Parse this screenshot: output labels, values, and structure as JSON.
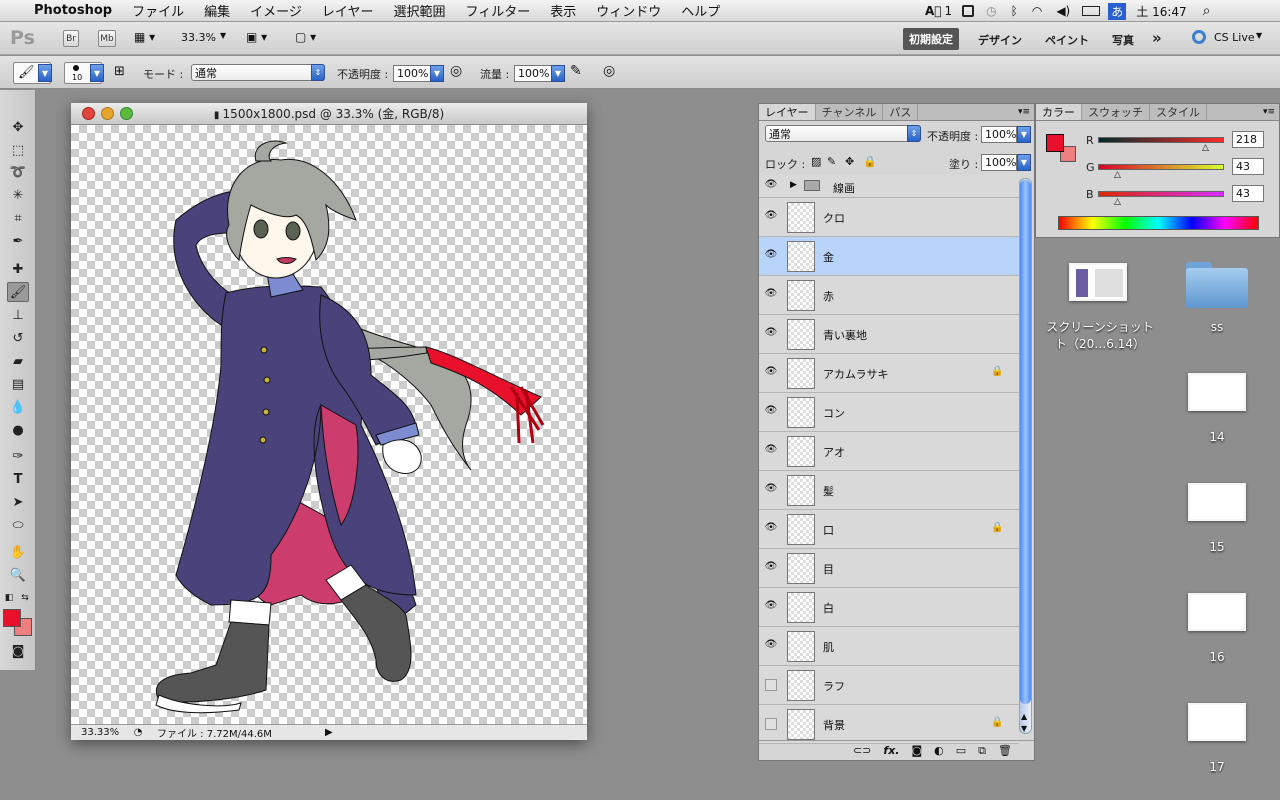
{
  "menubar": {
    "app_name": "Photoshop",
    "items": [
      "ファイル",
      "編集",
      "イメージ",
      "レイヤー",
      "選択範囲",
      "フィルター",
      "表示",
      "ウィンドウ",
      "ヘルプ"
    ],
    "tray_num": "1",
    "ime": "あ",
    "clock": "土 16:47"
  },
  "appbar": {
    "logo": "Ps",
    "br": "Br",
    "mb": "Mb",
    "zoom": "33.3%",
    "workspaces": [
      "初期設定",
      "デザイン",
      "ペイント",
      "写真"
    ],
    "more": "»",
    "cs_live": "CS Live"
  },
  "options": {
    "brush_size": "10",
    "mode_label": "モード :",
    "mode_value": "通常",
    "opacity_label": "不透明度 :",
    "opacity_value": "100%",
    "flow_label": "流量 :",
    "flow_value": "100%"
  },
  "document": {
    "title": "1500x1800.psd @ 33.3% (金, RGB/8)",
    "zoom_status": "33.33%",
    "file_status": "ファイル : 7.72M/44.6M"
  },
  "layers_panel": {
    "tabs": [
      "レイヤー",
      "チャンネル",
      "パス"
    ],
    "blend_mode": "通常",
    "opacity_label": "不透明度 :",
    "opacity_value": "100%",
    "lock_label": "ロック :",
    "fill_label": "塗り :",
    "fill_value": "100%",
    "group_name": "線画",
    "layers": [
      {
        "name": "クロ",
        "visible": true,
        "locked": false,
        "selected": false
      },
      {
        "name": "金",
        "visible": true,
        "locked": false,
        "selected": true
      },
      {
        "name": "赤",
        "visible": true,
        "locked": false,
        "selected": false
      },
      {
        "name": "青い裏地",
        "visible": true,
        "locked": false,
        "selected": false
      },
      {
        "name": "アカムラサキ",
        "visible": true,
        "locked": true,
        "selected": false
      },
      {
        "name": "コン",
        "visible": true,
        "locked": false,
        "selected": false
      },
      {
        "name": "アオ",
        "visible": true,
        "locked": false,
        "selected": false
      },
      {
        "name": "髪",
        "visible": true,
        "locked": false,
        "selected": false
      },
      {
        "name": "口",
        "visible": true,
        "locked": true,
        "selected": false
      },
      {
        "name": "目",
        "visible": true,
        "locked": false,
        "selected": false
      },
      {
        "name": "白",
        "visible": true,
        "locked": false,
        "selected": false
      },
      {
        "name": "肌",
        "visible": true,
        "locked": false,
        "selected": false
      },
      {
        "name": "ラフ",
        "visible": false,
        "locked": false,
        "selected": false
      },
      {
        "name": "背景",
        "visible": false,
        "locked": true,
        "selected": false
      }
    ]
  },
  "color_panel": {
    "tabs": [
      "カラー",
      "スウォッチ",
      "スタイル"
    ],
    "r_label": "R",
    "r_value": "218",
    "g_label": "G",
    "g_value": "43",
    "b_label": "B",
    "b_value": "43",
    "foreground": "#da2b2b",
    "background": "#f08080"
  },
  "desktop": {
    "screenshot_label_1": "スクリーンショット",
    "screenshot_label_2": "ト（20…6.14）",
    "folder_label": "ss",
    "files": [
      "14",
      "15",
      "16",
      "17"
    ]
  }
}
